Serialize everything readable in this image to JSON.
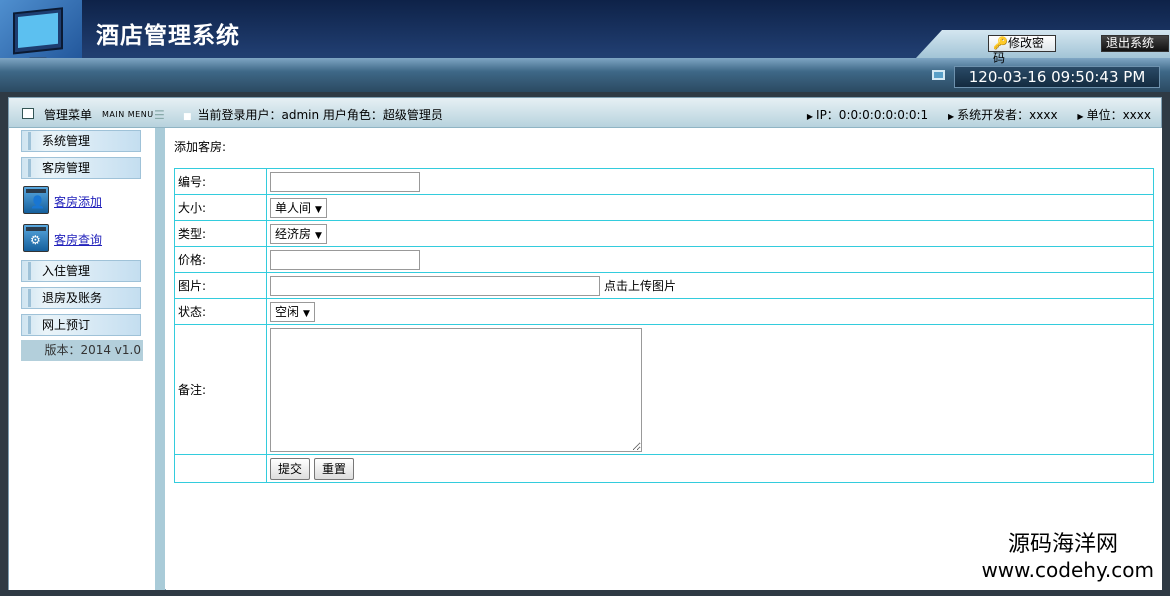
{
  "header": {
    "title": "酒店管理系统",
    "change_password": "修改密码",
    "exit": "退出系统",
    "datetime": "120-03-16 09:50:43 PM"
  },
  "topbar": {
    "menu_title": "管理菜单",
    "menu_sub": "MAIN MENU",
    "user_info": "当前登录用户：admin  用户角色：超级管理员",
    "ip": "IP：0:0:0:0:0:0:0:1",
    "developer": "系统开发者：xxxx",
    "unit": "单位：xxxx"
  },
  "sidebar": {
    "groups": [
      {
        "label": "系统管理"
      },
      {
        "label": "客房管理"
      },
      {
        "label": "入住管理"
      },
      {
        "label": "退房及账务"
      },
      {
        "label": "网上预订"
      }
    ],
    "sub_items": [
      {
        "label": "客房添加",
        "icon": "user-icon"
      },
      {
        "label": "客房查询",
        "icon": "gear-icon"
      }
    ],
    "version": "版本：2014 v1.0"
  },
  "form": {
    "section_label": "添加客房:",
    "fields": {
      "number_label": "编号:",
      "size_label": "大小:",
      "size_value": "单人间",
      "type_label": "类型:",
      "type_value": "经济房",
      "price_label": "价格:",
      "image_label": "图片:",
      "upload_text": "点击上传图片",
      "status_label": "状态:",
      "status_value": "空闲",
      "remark_label": "备注:"
    },
    "submit": "提交",
    "reset": "重置"
  },
  "watermark": {
    "line1": "源码海洋网",
    "line2": "www.codehy.com"
  }
}
